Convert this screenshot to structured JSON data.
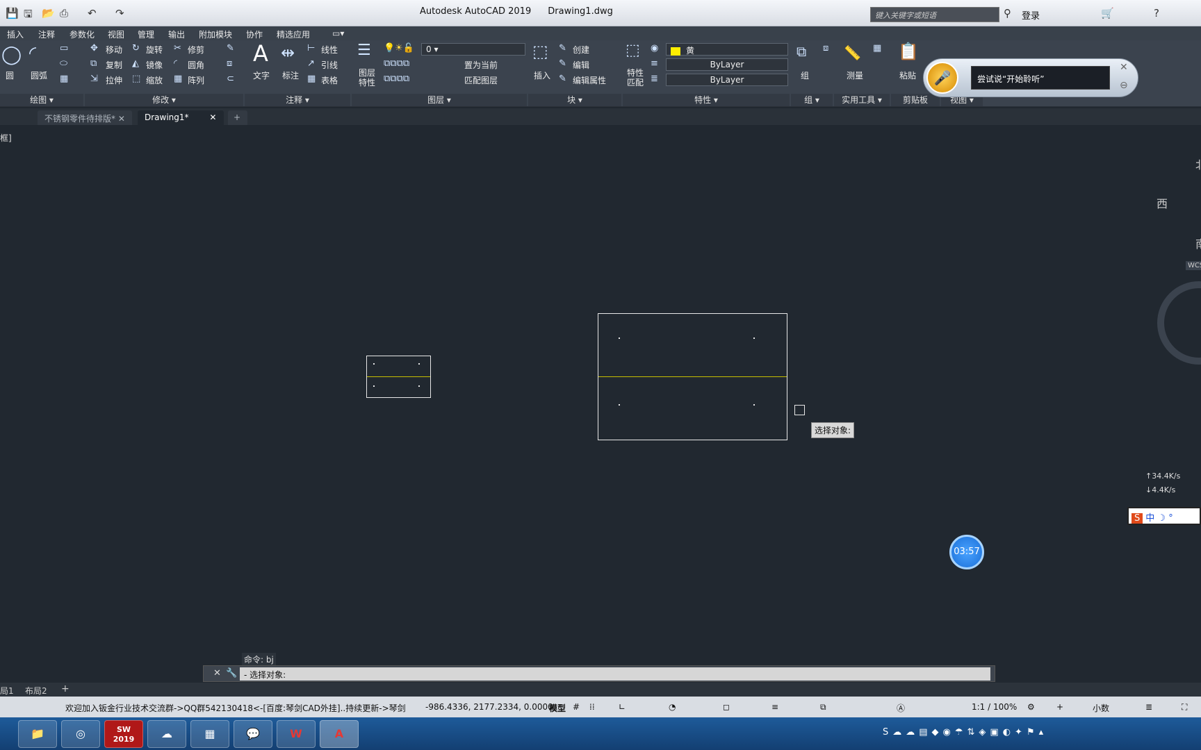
{
  "window": {
    "app_title": "Autodesk AutoCAD 2019",
    "file_name": "Drawing1.dwg"
  },
  "search": {
    "placeholder": "键入关键字或短语"
  },
  "header": {
    "login": "登录"
  },
  "menu": [
    "插入",
    "注释",
    "参数化",
    "视图",
    "管理",
    "输出",
    "附加模块",
    "协作",
    "精选应用"
  ],
  "ribbon": {
    "draw": {
      "circle": "圆",
      "arc": "圆弧",
      "panel": "绘图"
    },
    "modify": {
      "move": "移动",
      "rotate": "旋转",
      "trim": "修剪",
      "copy": "复制",
      "mirror": "镜像",
      "fillet": "圆角",
      "stretch": "拉伸",
      "scale": "缩放",
      "array": "阵列",
      "panel": "修改"
    },
    "annotation": {
      "text": "文字",
      "dimension": "标注",
      "linear": "线性",
      "leader": "引线",
      "table": "表格",
      "panel": "注释"
    },
    "layers": {
      "layer_props": "图层\n特性",
      "current_layer": "0",
      "set_current": "置为当前",
      "match_layer": "匹配图层",
      "panel": "图层"
    },
    "block": {
      "insert": "插入",
      "create": "创建",
      "edit": "编辑",
      "edit_attr": "编辑属性",
      "panel": "块"
    },
    "properties": {
      "match": "特性\n匹配",
      "color": "黄",
      "linetype": "ByLayer",
      "lineweight": "ByLayer",
      "panel": "特性"
    },
    "groups": {
      "group": "组",
      "panel": "组"
    },
    "utilities": {
      "measure": "测量",
      "panel": "实用工具"
    },
    "clipboard": {
      "paste": "粘贴",
      "panel": "剪贴板"
    },
    "view": {
      "panel": "视图"
    }
  },
  "tabs": [
    "不锈钢零件待排版*",
    "Drawing1*"
  ],
  "viewport": {
    "label": "框]",
    "tooltip": "选择对象:"
  },
  "voice": {
    "prompt": "尝试说“开始聆听”"
  },
  "compass": {
    "west": "西",
    "north": "北",
    "south": "南",
    "wcs": "WCS"
  },
  "net": {
    "up": "34.4K/s",
    "down": "4.4K/s"
  },
  "ime": {
    "label": "中"
  },
  "timer": {
    "time": "03:57"
  },
  "command": {
    "history": "命令: bj",
    "prompt": "- 选择对象:"
  },
  "layout_tabs": [
    "局1",
    "布局2"
  ],
  "status": {
    "message": "欢迎加入钣金行业技术交流群->QQ群542130418<-[百度:琴剑CAD外挂]..持续更新->琴剑",
    "coords": "-986.4336, 2177.2334, 0.0000",
    "model": "模型",
    "scale": "1:1 / 100%",
    "units": "小数"
  },
  "taskbar": {
    "apps": [
      "SW 2019",
      "AutoCAD"
    ]
  }
}
